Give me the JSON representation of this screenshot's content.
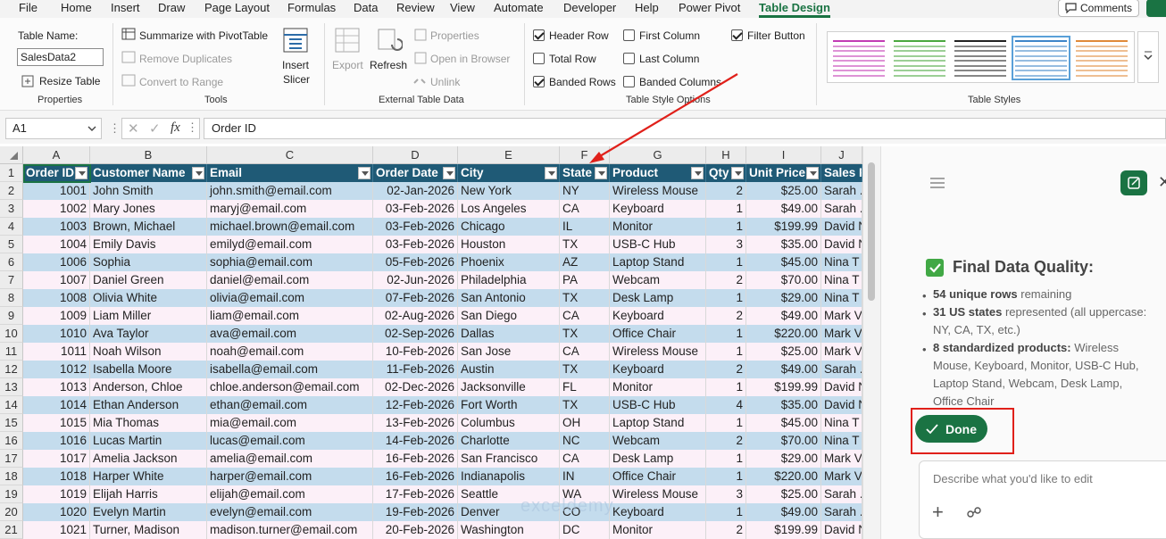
{
  "menu": {
    "items": [
      "File",
      "Home",
      "Insert",
      "Draw",
      "Page Layout",
      "Formulas",
      "Data",
      "Review",
      "View",
      "Automate",
      "Developer",
      "Help",
      "Power Pivot",
      "Table Design"
    ],
    "active": "Table Design",
    "comments_label": "Comments"
  },
  "ribbon": {
    "properties": {
      "table_name_label": "Table Name:",
      "table_name_value": "SalesData2",
      "resize_label": "Resize Table",
      "group_label": "Properties"
    },
    "tools": {
      "summarize_label": "Summarize with PivotTable",
      "remove_dup_label": "Remove Duplicates",
      "convert_label": "Convert to Range",
      "insert_slicer_label1": "Insert",
      "insert_slicer_label2": "Slicer",
      "group_label": "Tools"
    },
    "external": {
      "export_label": "Export",
      "refresh_label": "Refresh",
      "properties_label": "Properties",
      "open_browser_label": "Open in Browser",
      "unlink_label": "Unlink",
      "group_label": "External Table Data"
    },
    "style_options": {
      "header_row": "Header Row",
      "total_row": "Total Row",
      "banded_rows": "Banded Rows",
      "first_column": "First Column",
      "last_column": "Last Column",
      "banded_columns": "Banded Columns",
      "filter_button": "Filter Button",
      "group_label": "Table Style Options"
    },
    "styles": {
      "group_label": "Table Styles",
      "swatch_colors": [
        "#c23bb4",
        "#4aa83f",
        "#222222",
        "#3f86c9",
        "#e08a3a"
      ]
    }
  },
  "formula_bar": {
    "name_box": "A1",
    "fx": "fx",
    "formula": "Order ID"
  },
  "sheet": {
    "col_letters": [
      "A",
      "B",
      "C",
      "D",
      "E",
      "F",
      "G",
      "H",
      "I",
      "J"
    ],
    "row_numbers": [
      "1",
      "2",
      "3",
      "4",
      "5",
      "6",
      "7",
      "8",
      "9",
      "10",
      "11",
      "12",
      "13",
      "14",
      "15",
      "16",
      "17",
      "18",
      "19",
      "20",
      "21"
    ],
    "headers": [
      "Order ID",
      "Customer Name",
      "Email",
      "Order Date",
      "City",
      "State",
      "Product",
      "Qty",
      "Unit Price",
      "Sales R"
    ],
    "rows": [
      [
        "1001",
        "John Smith",
        "john.smith@email.com",
        "02-Jan-2026",
        "New York",
        "NY",
        "Wireless Mouse",
        "2",
        "$25.00",
        "Sarah ."
      ],
      [
        "1002",
        "Mary Jones",
        "maryj@email.com",
        "03-Feb-2026",
        "Los Angeles",
        "CA",
        "Keyboard",
        "1",
        "$49.00",
        "Sarah ."
      ],
      [
        "1003",
        "Brown, Michael",
        "michael.brown@email.com",
        "03-Feb-2026",
        "Chicago",
        "IL",
        "Monitor",
        "1",
        "$199.99",
        "David N"
      ],
      [
        "1004",
        "Emily Davis",
        "emilyd@email.com",
        "03-Feb-2026",
        "Houston",
        "TX",
        "USB-C Hub",
        "3",
        "$35.00",
        "David N"
      ],
      [
        "1006",
        "Sophia",
        "sophia@email.com",
        "05-Feb-2026",
        "Phoenix",
        "AZ",
        "Laptop Stand",
        "1",
        "$45.00",
        "Nina T"
      ],
      [
        "1007",
        "Daniel Green",
        "daniel@email.com",
        "02-Jun-2026",
        "Philadelphia",
        "PA",
        "Webcam",
        "2",
        "$70.00",
        "Nina T"
      ],
      [
        "1008",
        "Olivia White",
        "olivia@email.com",
        "07-Feb-2026",
        "San Antonio",
        "TX",
        "Desk Lamp",
        "1",
        "$29.00",
        "Nina T"
      ],
      [
        "1009",
        "Liam Miller",
        "liam@email.com",
        "02-Aug-2026",
        "San Diego",
        "CA",
        "Keyboard",
        "2",
        "$49.00",
        "Mark V"
      ],
      [
        "1010",
        "Ava Taylor",
        "ava@email.com",
        "02-Sep-2026",
        "Dallas",
        "TX",
        "Office Chair",
        "1",
        "$220.00",
        "Mark V"
      ],
      [
        "1011",
        "Noah Wilson",
        "noah@email.com",
        "10-Feb-2026",
        "San Jose",
        "CA",
        "Wireless Mouse",
        "1",
        "$25.00",
        "Mark V"
      ],
      [
        "1012",
        "Isabella Moore",
        "isabella@email.com",
        "11-Feb-2026",
        "Austin",
        "TX",
        "Keyboard",
        "2",
        "$49.00",
        "Sarah ."
      ],
      [
        "1013",
        "Anderson, Chloe",
        "chloe.anderson@email.com",
        "02-Dec-2026",
        "Jacksonville",
        "FL",
        "Monitor",
        "1",
        "$199.99",
        "David N"
      ],
      [
        "1014",
        "Ethan Anderson",
        "ethan@email.com",
        "12-Feb-2026",
        "Fort Worth",
        "TX",
        "USB-C Hub",
        "4",
        "$35.00",
        "David N"
      ],
      [
        "1015",
        "Mia Thomas",
        "mia@email.com",
        "13-Feb-2026",
        "Columbus",
        "OH",
        "Laptop Stand",
        "1",
        "$45.00",
        "Nina T"
      ],
      [
        "1016",
        "Lucas Martin",
        "lucas@email.com",
        "14-Feb-2026",
        "Charlotte",
        "NC",
        "Webcam",
        "2",
        "$70.00",
        "Nina T"
      ],
      [
        "1017",
        "Amelia Jackson",
        "amelia@email.com",
        "16-Feb-2026",
        "San Francisco",
        "CA",
        "Desk Lamp",
        "1",
        "$29.00",
        "Mark V"
      ],
      [
        "1018",
        "Harper White",
        "harper@email.com",
        "16-Feb-2026",
        "Indianapolis",
        "IN",
        "Office Chair",
        "1",
        "$220.00",
        "Mark V"
      ],
      [
        "1019",
        "Elijah Harris",
        "elijah@email.com",
        "17-Feb-2026",
        "Seattle",
        "WA",
        "Wireless Mouse",
        "3",
        "$25.00",
        "Sarah ."
      ],
      [
        "1020",
        "Evelyn Martin",
        "evelyn@email.com",
        "19-Feb-2026",
        "Denver",
        "CO",
        "Keyboard",
        "1",
        "$49.00",
        "Sarah ."
      ],
      [
        "1021",
        "Turner, Madison",
        "madison.turner@email.com",
        "20-Feb-2026",
        "Washington",
        "DC",
        "Monitor",
        "2",
        "$199.99",
        "David N"
      ]
    ],
    "band_colors": {
      "odd": "#c4dced",
      "even": "#fcf0f8",
      "header": "#1f5a76"
    }
  },
  "copilot": {
    "heading": "Final Data Quality:",
    "bullets": [
      {
        "bold": "54 unique rows",
        "rest": " remaining"
      },
      {
        "bold": "31 US states",
        "rest": " represented (all uppercase:",
        "line2": "NY, CA, TX, etc.)"
      },
      {
        "bold": "8 standardized products:",
        "rest": " Wireless",
        "line2": "Mouse, Keyboard, Monitor, USB-C Hub,",
        "line3": "Laptop Stand, Webcam, Desk Lamp,",
        "line4": "Office Chair"
      }
    ],
    "done_label": "Done",
    "edit_placeholder": "Describe what you'd like to edit"
  },
  "watermark": "exceldemy"
}
